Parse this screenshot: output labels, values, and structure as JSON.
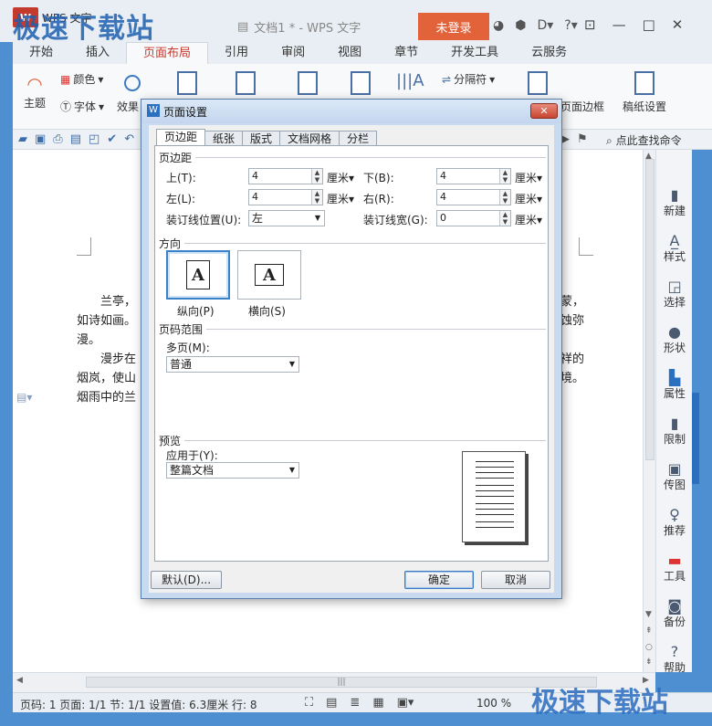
{
  "window": {
    "app_name": "WPS 文字",
    "doc_title": "文档1 * - WPS 文字",
    "login": "未登录",
    "watermark": "极速下载站"
  },
  "menu_tabs": [
    "开始",
    "插入",
    "页面布局",
    "引用",
    "审阅",
    "视图",
    "章节",
    "开发工具",
    "云服务"
  ],
  "active_tab": "页面布局",
  "ribbon": {
    "theme": "主题",
    "color": "颜色",
    "font": "字体",
    "effect": "效果",
    "separator": "分隔符",
    "page_border": "页面边框",
    "paper_setting": "稿纸设置"
  },
  "toolbar": {
    "search_cmd": "点此查找命令"
  },
  "document": {
    "lines": [
      "兰亭，",
      "如诗如画。",
      "漫。",
      "漫步在",
      "烟岚，使山",
      "烟雨中的兰"
    ],
    "right_lines": [
      "蒙，",
      "蚀弥",
      "",
      "祥的",
      "境。"
    ]
  },
  "side_panel": [
    "新建",
    "样式",
    "选择",
    "形状",
    "属性",
    "限制",
    "传图",
    "推荐",
    "工具",
    "备份",
    "帮助"
  ],
  "status": {
    "text": "页码: 1  页面: 1/1  节: 1/1  设置值: 6.3厘米  行: 8",
    "zoom": "100 %"
  },
  "dialog": {
    "title": "页面设置",
    "tabs": [
      "页边距",
      "纸张",
      "版式",
      "文档网格",
      "分栏"
    ],
    "margins_section": "页边距",
    "top_label": "上(T):",
    "top_value": "4",
    "bottom_label": "下(B):",
    "bottom_value": "4",
    "left_label": "左(L):",
    "left_value": "4",
    "right_label": "右(R):",
    "right_value": "4",
    "gutter_pos_label": "装订线位置(U):",
    "gutter_pos_value": "左",
    "gutter_width_label": "装订线宽(G):",
    "gutter_width_value": "0",
    "unit": "厘米",
    "orientation_section": "方向",
    "portrait": "纵向(P)",
    "landscape": "横向(S)",
    "page_range_section": "页码范围",
    "multi_page_label": "多页(M):",
    "multi_page_value": "普通",
    "preview_section": "预览",
    "apply_to_label": "应用于(Y):",
    "apply_to_value": "整篇文档",
    "default_btn": "默认(D)...",
    "ok_btn": "确定",
    "cancel_btn": "取消"
  }
}
